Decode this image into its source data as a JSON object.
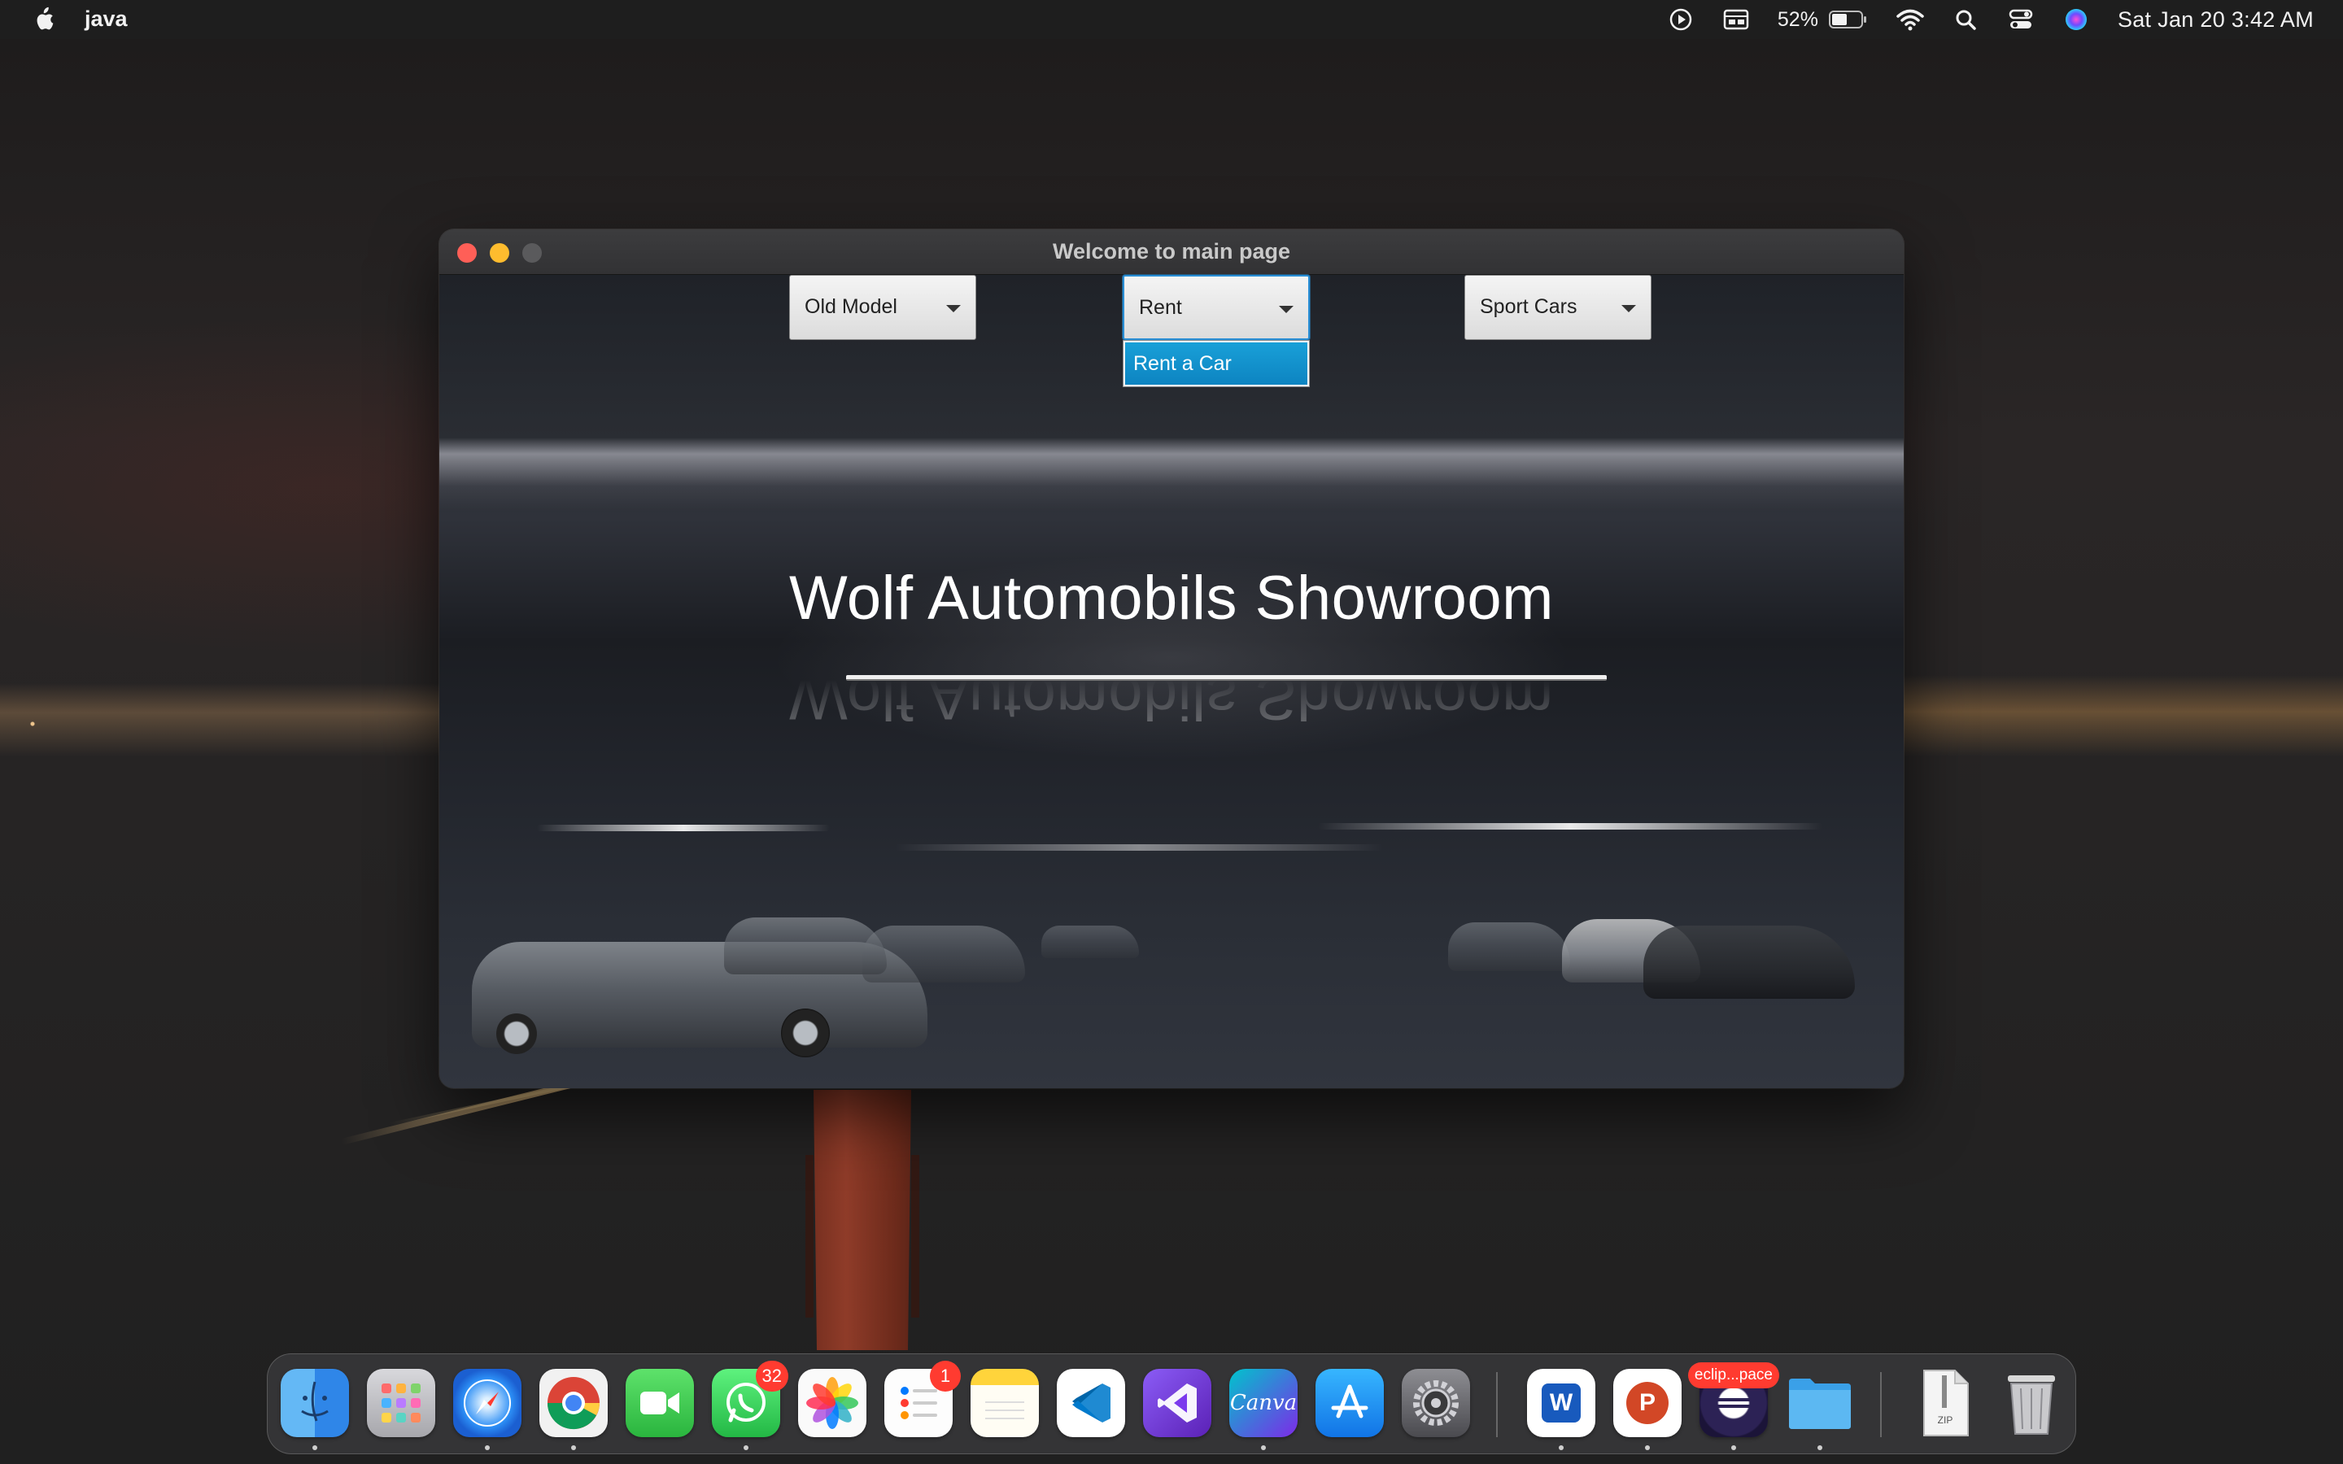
{
  "menubar": {
    "app_name": "java",
    "battery_percent": "52%",
    "clock": "Sat Jan 20  3:42 AM",
    "icons": [
      "apple-icon",
      "play-circle-icon",
      "display-icon",
      "battery-icon",
      "wifi-icon",
      "search-icon",
      "control-center-icon",
      "siri-icon"
    ]
  },
  "window": {
    "title": "Welcome to main page",
    "combos": [
      {
        "label": "Old Model"
      },
      {
        "label": "Rent"
      },
      {
        "label": "Sport Cars"
      }
    ],
    "dropdown": {
      "items": [
        "Rent a Car"
      ],
      "selected": "Rent a Car"
    },
    "heading": "Wolf Automobils Showroom"
  },
  "dock": {
    "apps": [
      {
        "name": "Finder",
        "icon": "finder-icon"
      },
      {
        "name": "Launchpad",
        "icon": "launchpad-icon"
      },
      {
        "name": "Safari",
        "icon": "safari-icon"
      },
      {
        "name": "Chrome",
        "icon": "chrome-icon"
      },
      {
        "name": "FaceTime",
        "icon": "facetime-icon"
      },
      {
        "name": "WhatsApp",
        "icon": "whatsapp-icon",
        "badge": "32"
      },
      {
        "name": "Photos",
        "icon": "photos-icon"
      },
      {
        "name": "Reminders",
        "icon": "reminders-icon",
        "badge": "1"
      },
      {
        "name": "Notes",
        "icon": "notes-icon"
      },
      {
        "name": "Visual Studio Code",
        "icon": "vscode-icon"
      },
      {
        "name": "Visual Studio",
        "icon": "visual-studio-icon"
      },
      {
        "name": "Canva",
        "icon": "canva-icon",
        "label": "Canva"
      },
      {
        "name": "App Store",
        "icon": "app-store-icon"
      },
      {
        "name": "System Settings",
        "icon": "settings-icon"
      },
      {
        "name": "Word",
        "icon": "word-icon",
        "label": "W"
      },
      {
        "name": "PowerPoint",
        "icon": "powerpoint-icon",
        "label": "P"
      },
      {
        "name": "Eclipse",
        "icon": "eclipse-icon",
        "badge": "eclip...pace"
      },
      {
        "name": "Folder",
        "icon": "folder-icon"
      },
      {
        "name": "Zip",
        "icon": "zip-file-icon",
        "label": "ZIP"
      },
      {
        "name": "Trash",
        "icon": "trash-icon"
      }
    ]
  },
  "colors": {
    "accent": "#0d84c1",
    "close": "#ff5f57",
    "minimize": "#febc2e",
    "badge": "#ff3b30"
  }
}
